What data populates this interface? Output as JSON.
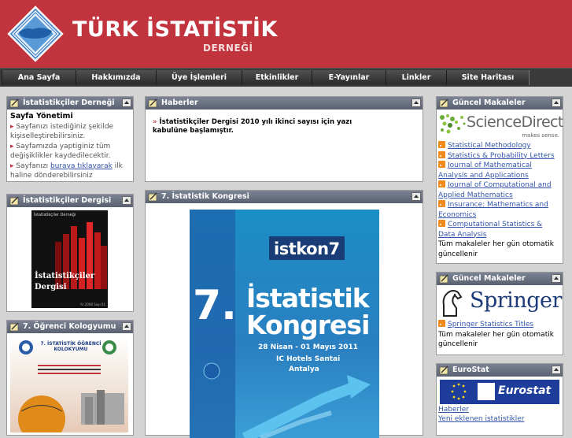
{
  "header": {
    "title": "TÜRK İSTATİSTİK",
    "subtitle": "DERNEĞİ"
  },
  "nav": [
    "Ana Sayfa",
    "Hakkımızda",
    "Üye İşlemleri",
    "Etkinlikler",
    "E-Yayınlar",
    "Linkler",
    "Site Haritası"
  ],
  "left": {
    "panel1": {
      "title": "İstatistikçiler Derneği",
      "heading": "Sayfa Yönetimi",
      "items": [
        "Sayfanızı istediğiniz şekilde kişiselleştirebilirsiniz.",
        "Sayfamızda yaptiginiz tüm değişiklikler kaydedilecektir."
      ],
      "item3_pre": "Sayfanızı ",
      "item3_link": "buraya tıklayarak",
      "item3_post": " ilk haline dönderebilirsiniz"
    },
    "panel2": {
      "title": "İstatistikçiler Dergisi",
      "cover_top": "İstatistikçiler Derneği",
      "cover_title1": "İstatistikçiler",
      "cover_title2": "Dergisi",
      "cover_issue": "Yıl 2008 Sayı 01"
    },
    "panel3": {
      "title": "7. Öğrenci Kologyumu",
      "poster_top": "7. İSTATİSTİK ÖĞRENCİ KOLOKYUMU"
    }
  },
  "center": {
    "news": {
      "title": "Haberler",
      "item": "İstatistikçiler Dergisi 2010 yılı ikinci sayısı için yazı kabulüne başlamıştır."
    },
    "congress": {
      "title": "7. İstatistik Kongresi",
      "brand": "istkon7",
      "big_num": "7.",
      "line1": "İstatistik",
      "line2": "Kongresi",
      "dates": "28 Nisan - 01 Mayıs 2011",
      "venue": "IC Hotels Santai",
      "city": "Antalya"
    }
  },
  "right": {
    "panel1": {
      "title": "Güncel Makaleler",
      "brand": "ScienceDirect",
      "tagline": "makes sense.",
      "links": [
        "Statistical Methodology",
        "Statistics & Probability Letters",
        "Journal of Mathematical Analysis and Applications",
        "Journal of Computational and Applied Mathematics",
        "Insurance: Mathematics and Economics",
        "Computational Statistics & Data Analysis"
      ],
      "note": "Tüm makaleler her gün otomatik güncellenir"
    },
    "panel2": {
      "title": "Güncel Makaleler",
      "brand": "Springer",
      "link": "Springer Statistics Titles",
      "note": "Tüm makaleler her gün otomatik güncellenir"
    },
    "panel3": {
      "title": "EuroStat",
      "brand": "Eurostat",
      "links": [
        "Haberler",
        "Yeni eklenen istatistikler"
      ]
    }
  }
}
